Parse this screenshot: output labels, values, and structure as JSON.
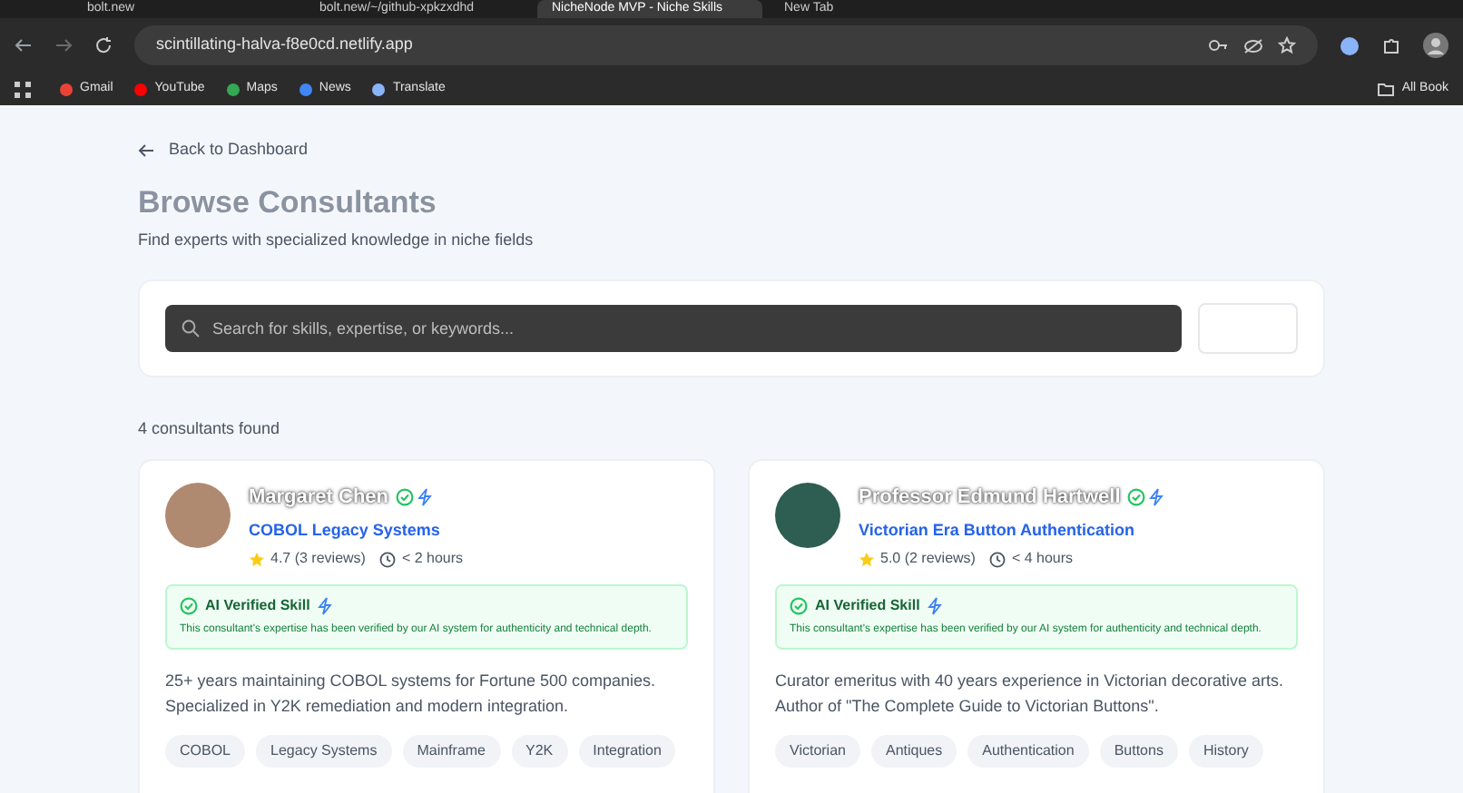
{
  "browser": {
    "tabs": [
      {
        "title": "bolt.new",
        "selected": false
      },
      {
        "title": "bolt.new/~/github-xpkzxdhd",
        "selected": false
      },
      {
        "title": "NicheNode MVP - Niche Skills",
        "selected": true
      },
      {
        "title": "New Tab",
        "selected": false
      }
    ],
    "url": "scintillating-halva-f8e0cd.netlify.app",
    "bookmarks": [
      {
        "label": "Gmail",
        "color": "#ea4335"
      },
      {
        "label": "YouTube",
        "color": "#ff0000"
      },
      {
        "label": "Maps",
        "color": "#34a853"
      },
      {
        "label": "News",
        "color": "#4285f4"
      },
      {
        "label": "Translate",
        "color": "#8ab4f8"
      }
    ],
    "all_bookmarks": "All Book"
  },
  "back_link": "Back to Dashboard",
  "title": "Browse Consultants",
  "subtitle": "Find experts with specialized knowledge in niche fields",
  "search": {
    "placeholder": "Search for skills, expertise, or keywords..."
  },
  "results_count": "4 consultants found",
  "consultants": [
    {
      "name": "Margaret Chen",
      "skill": "COBOL Legacy Systems",
      "rating": "4.7",
      "reviews": "(3 reviews)",
      "response": "< 2 hours",
      "verified": true,
      "verified_title": "AI Verified Skill",
      "verified_text": "This consultant's expertise has been verified by our AI system for authenticity and technical depth.",
      "bio": "25+ years maintaining COBOL systems for Fortune 500 companies. Specialized in Y2K remediation and modern integration.",
      "tags": [
        "COBOL",
        "Legacy Systems",
        "Mainframe",
        "Y2K",
        "Integration"
      ]
    },
    {
      "name": "Professor Edmund Hartwell",
      "skill": "Victorian Era Button Authentication",
      "rating": "5.0",
      "reviews": "(2 reviews)",
      "response": "< 4 hours",
      "verified": true,
      "verified_title": "AI Verified Skill",
      "verified_text": "This consultant's expertise has been verified by our AI system for authenticity and technical depth.",
      "bio": "Curator emeritus with 40 years experience in Victorian decorative arts. Author of \"The Complete Guide to Victorian Buttons\".",
      "tags": [
        "Victorian",
        "Antiques",
        "Authentication",
        "Buttons",
        "History"
      ]
    }
  ]
}
